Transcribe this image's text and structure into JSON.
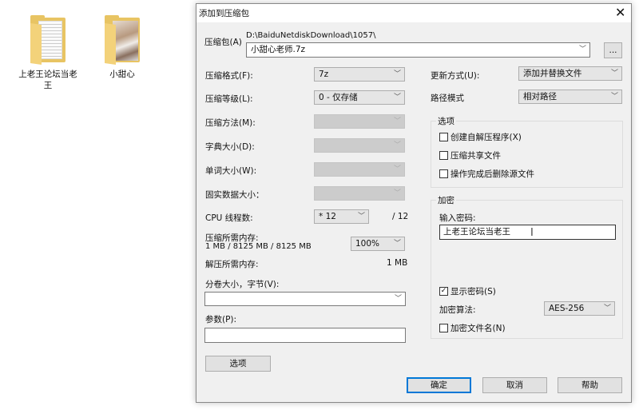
{
  "desktop": {
    "items": [
      {
        "label": "上老王论坛当老王",
        "type": "folder-documents"
      },
      {
        "label": "小甜心",
        "type": "folder-photos"
      }
    ]
  },
  "dialog": {
    "title": "添加到压缩包",
    "archive": {
      "label": "压缩包(A)",
      "path": "D:\\BaiduNetdiskDownload\\1057\\",
      "value": "小甜心老师.7z",
      "browse": "..."
    },
    "format": {
      "label": "压缩格式(F):",
      "value": "7z"
    },
    "level": {
      "label": "压缩等级(L):",
      "value": "0 - 仅存储"
    },
    "method": {
      "label": "压缩方法(M):",
      "value": ""
    },
    "dict": {
      "label": "字典大小(D):",
      "value": ""
    },
    "word": {
      "label": "单词大小(W):",
      "value": ""
    },
    "solid": {
      "label": "固实数据大小：",
      "value": ""
    },
    "cpu": {
      "label": "CPU 线程数:",
      "value": "* 12",
      "max": "/ 12"
    },
    "mem": {
      "label": "压缩所需内存:",
      "detail": "1 MB / 8125 MB / 8125 MB",
      "value": "100%"
    },
    "decomp": {
      "label": "解压所需内存:",
      "value": "1 MB"
    },
    "volume": {
      "label": "分卷大小，字节(V):",
      "value": ""
    },
    "params": {
      "label": "参数(P):",
      "value": ""
    },
    "options_button": "选项",
    "update": {
      "label": "更新方式(U):",
      "value": "添加并替换文件"
    },
    "pathmode": {
      "label": "路径模式",
      "value": "相对路径"
    },
    "options": {
      "title": "选项",
      "items": [
        {
          "label": "创建自解压程序(X)",
          "checked": false
        },
        {
          "label": "压缩共享文件",
          "checked": false
        },
        {
          "label": "操作完成后删除源文件",
          "checked": false
        }
      ]
    },
    "encryption": {
      "title": "加密",
      "password_label": "输入密码:",
      "password": "上老王论坛当老王",
      "show_password": {
        "label": "显示密码(S)",
        "checked": true
      },
      "method_label": "加密算法:",
      "method": "AES-256",
      "encrypt_names": {
        "label": "加密文件名(N)",
        "checked": false
      }
    },
    "buttons": {
      "ok": "确定",
      "cancel": "取消",
      "help": "帮助"
    },
    "accent": "#0078d7"
  }
}
